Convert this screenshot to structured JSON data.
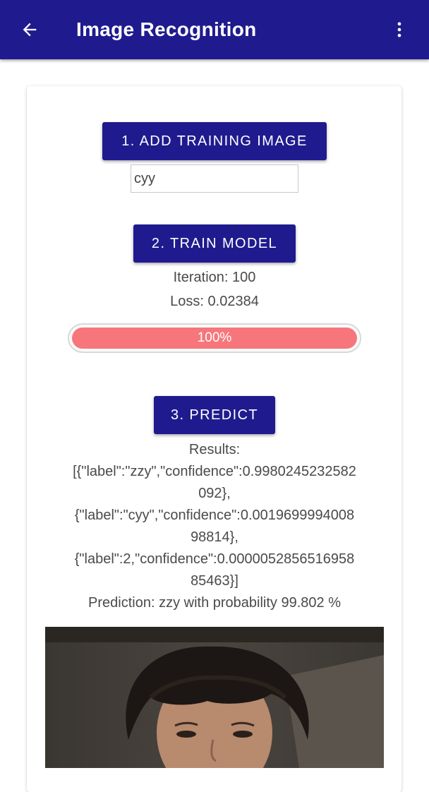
{
  "appbar": {
    "title": "Image Recognition",
    "back_icon": "arrow-back-icon",
    "menu_icon": "more-vert-icon",
    "color": "#1f1b8e"
  },
  "training": {
    "add_button_label": "1. ADD TRAINING IMAGE",
    "label_input_value": "cyy"
  },
  "model": {
    "train_button_label": "2. TRAIN MODEL",
    "iteration_text": "Iteration: 100",
    "loss_text": "Loss: 0.02384",
    "progress_percent": 100,
    "progress_label": "100%",
    "progress_color": "#f6767b"
  },
  "predict": {
    "button_label": "3. PREDICT",
    "results_heading": "Results:",
    "results_lines": [
      "[{\"label\":\"zzy\",\"confidence\":0.9980245232582",
      "092},",
      "{\"label\":\"cyy\",\"confidence\":0.0019699994008",
      "98814},",
      "{\"label\":2,\"confidence\":0.0000052856516958",
      "85463}]"
    ],
    "prediction_text": "Prediction: zzy with probability 99.802 %"
  },
  "photo": {
    "description_icon": "camera-photo"
  }
}
